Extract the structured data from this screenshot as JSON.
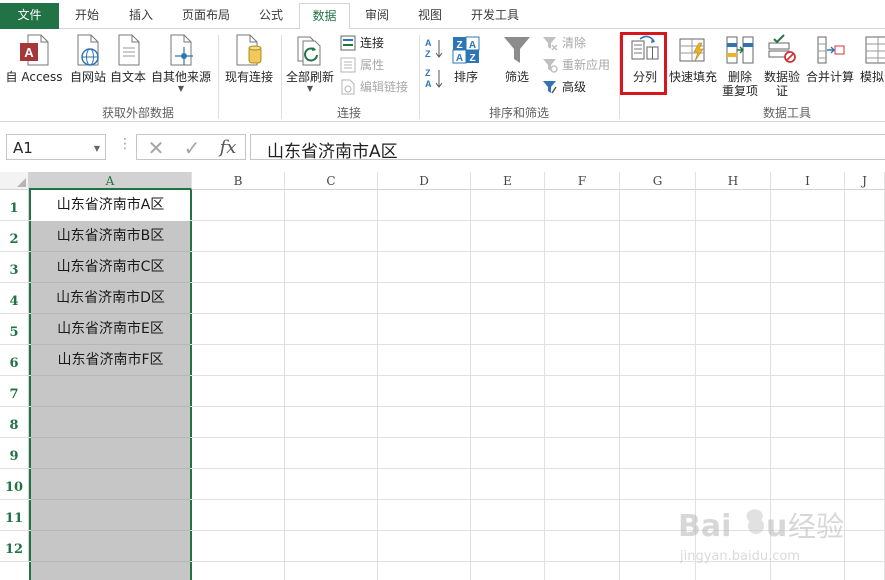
{
  "tabs": [
    {
      "label": "文件",
      "state": "file"
    },
    {
      "label": "开始",
      "state": ""
    },
    {
      "label": "插入",
      "state": ""
    },
    {
      "label": "页面布局",
      "state": ""
    },
    {
      "label": "公式",
      "state": ""
    },
    {
      "label": "数据",
      "state": "active"
    },
    {
      "label": "审阅",
      "state": ""
    },
    {
      "label": "视图",
      "state": ""
    },
    {
      "label": "开发工具",
      "state": ""
    }
  ],
  "ribbon": {
    "external": {
      "group_label": "获取外部数据",
      "access": "自 Access",
      "web": "自网站",
      "text": "自文本",
      "other": "自其他来源"
    },
    "existing_connections": "现有连接",
    "connections": {
      "group_label": "连接",
      "refresh_all": "全部刷新",
      "connections": "连接",
      "properties": "属性",
      "edit_links": "编辑链接"
    },
    "sort_filter": {
      "group_label": "排序和筛选",
      "sort": "排序",
      "filter": "筛选",
      "clear": "清除",
      "reapply": "重新应用",
      "advanced": "高级"
    },
    "data_tools": {
      "group_label": "数据工具",
      "text_to_columns": "分列",
      "flash_fill": "快速填充",
      "remove_duplicates_1": "删除",
      "remove_duplicates_2": "重复项",
      "validation_1": "数据验",
      "validation_2": "证",
      "consolidate": "合并计算",
      "whatif": "模拟分"
    }
  },
  "formula_bar": {
    "name_box": "A1",
    "fx": "fx",
    "value": "山东省济南市A区"
  },
  "grid": {
    "columns": [
      "A",
      "B",
      "C",
      "D",
      "E",
      "F",
      "G",
      "H",
      "I",
      "J"
    ],
    "rows": [
      "1",
      "2",
      "3",
      "4",
      "5",
      "6",
      "7",
      "8",
      "9",
      "10",
      "11",
      "12"
    ],
    "col_a_values": [
      "山东省济南市A区",
      "山东省济南市B区",
      "山东省济南市C区",
      "山东省济南市D区",
      "山东省济南市E区",
      "山东省济南市F区"
    ]
  },
  "watermark": {
    "brand": "Baidu经验",
    "url": "jingyan.baidu.com"
  },
  "colors": {
    "accent": "#217346",
    "highlight_box": "#d8161d",
    "selection": "#c6c6c6"
  },
  "icons": [
    "access-icon",
    "web-icon",
    "text-file-icon",
    "other-sources-icon",
    "existing-connections-icon",
    "refresh-all-icon",
    "connections-icon",
    "properties-icon",
    "edit-links-icon",
    "sort-az-icon",
    "sort-za-icon",
    "sort-icon",
    "filter-icon",
    "clear-filter-icon",
    "reapply-icon",
    "advanced-filter-icon",
    "text-to-columns-icon",
    "flash-fill-icon",
    "remove-duplicates-icon",
    "data-validation-icon",
    "consolidate-icon",
    "whatif-icon"
  ]
}
